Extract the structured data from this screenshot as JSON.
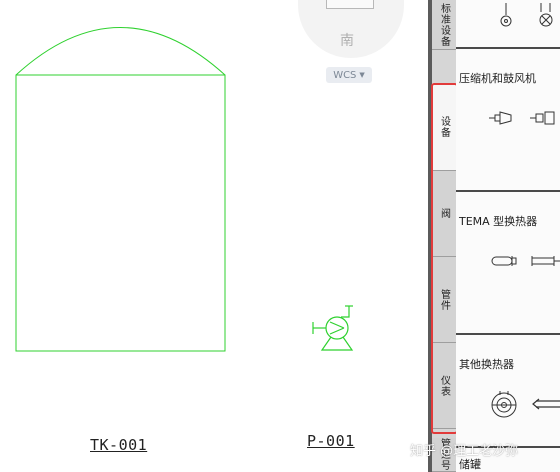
{
  "drawing": {
    "tank_tag": "TK-001",
    "pump_tag": "P-001",
    "stroke_color": "#2fd12f"
  },
  "viewcube": {
    "south_label": "南",
    "wcs_label": "WCS",
    "wcs_arrow_icon": "chevron-down-icon"
  },
  "palette": {
    "tabs": [
      "标准设备",
      "设备",
      "阀",
      "管件",
      "仪表",
      "管道号"
    ],
    "active_tab": "设备",
    "highlight_color": "#e23b3b",
    "sections": [
      {
        "title": "压缩机和鼓风机"
      },
      {
        "title": "TEMA 型换热器"
      },
      {
        "title": "其他换热器"
      },
      {
        "title": "储罐"
      }
    ]
  },
  "watermark": "知乎 @理工老沙弥"
}
